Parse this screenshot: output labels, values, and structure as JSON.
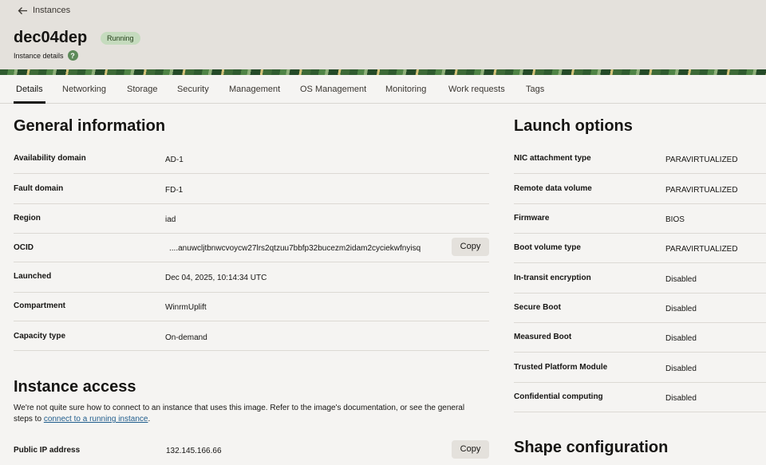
{
  "header": {
    "back_label": "Instances",
    "title": "dec04dep",
    "status": "Running",
    "subtitle": "Instance details",
    "help_symbol": "?"
  },
  "tabs": [
    {
      "label": "Details",
      "active": true
    },
    {
      "label": "Networking"
    },
    {
      "label": "Storage"
    },
    {
      "label": "Security"
    },
    {
      "label": "Management"
    },
    {
      "label": "OS Management"
    },
    {
      "label": "Monitoring"
    },
    {
      "label": "Work requests"
    },
    {
      "label": "Tags"
    }
  ],
  "general": {
    "title": "General information",
    "rows": [
      {
        "label": "Availability domain",
        "value": "AD-1"
      },
      {
        "label": "Fault domain",
        "value": "FD-1"
      },
      {
        "label": "Region",
        "value": "iad"
      },
      {
        "label": "OCID",
        "value": "....anuwcljtbnwcvoycw27lrs2qtzuu7bbfp32bucezm2idam2cyciekwfnyisq"
      },
      {
        "label": "Launched",
        "value": "Dec 04, 2025, 10:14:34 UTC"
      },
      {
        "label": "Compartment",
        "value": "WinrmUplift"
      },
      {
        "label": "Capacity type",
        "value": "On-demand"
      }
    ],
    "copy_label": "Copy"
  },
  "access": {
    "title": "Instance access",
    "text_before": "We're not quite sure how to connect to an instance that uses this image. Refer to the image's documentation, or see the general steps to ",
    "link_text": "connect to a running instance",
    "text_after": ".",
    "ip_label": "Public IP address",
    "ip_value": "132.145.166.66",
    "copy_label": "Copy"
  },
  "launch": {
    "title": "Launch options",
    "rows": [
      {
        "label": "NIC attachment type",
        "value": "PARAVIRTUALIZED"
      },
      {
        "label": "Remote data volume",
        "value": "PARAVIRTUALIZED"
      },
      {
        "label": "Firmware",
        "value": "BIOS"
      },
      {
        "label": "Boot volume type",
        "value": "PARAVIRTUALIZED"
      },
      {
        "label": "In-transit encryption",
        "value": "Disabled"
      },
      {
        "label": "Secure Boot",
        "value": "Disabled"
      },
      {
        "label": "Measured Boot",
        "value": "Disabled"
      },
      {
        "label": "Trusted Platform Module",
        "value": "Disabled"
      },
      {
        "label": "Confidential computing",
        "value": "Disabled"
      }
    ]
  },
  "shape": {
    "title": "Shape configuration"
  }
}
